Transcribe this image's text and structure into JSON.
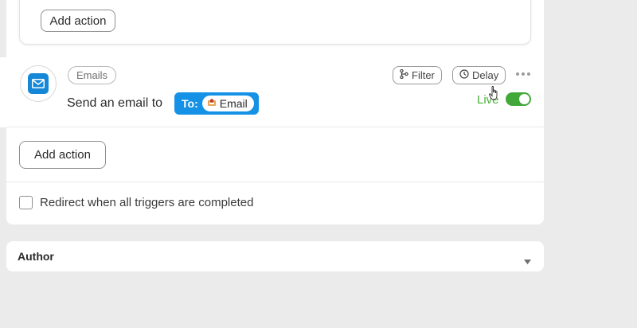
{
  "top_card": {
    "add_action_label": "Add action"
  },
  "action": {
    "app_tag": "Emails",
    "send_text": "Send an email to",
    "to_label": "To:",
    "email_chip": "Email",
    "filter_label": "Filter",
    "delay_label": "Delay",
    "status_label": "Live",
    "status_color": "#4caf3a",
    "accent_color": "#1592e6",
    "icons": [
      "envelope-icon",
      "filter-branch-icon",
      "clock-icon",
      "more-dots-icon",
      "email-avatar-icon",
      "hand-cursor-icon"
    ]
  },
  "add_action_label": "Add action",
  "redirect": {
    "label": "Redirect when all triggers are completed",
    "checked": false
  },
  "author": {
    "title": "Author"
  }
}
